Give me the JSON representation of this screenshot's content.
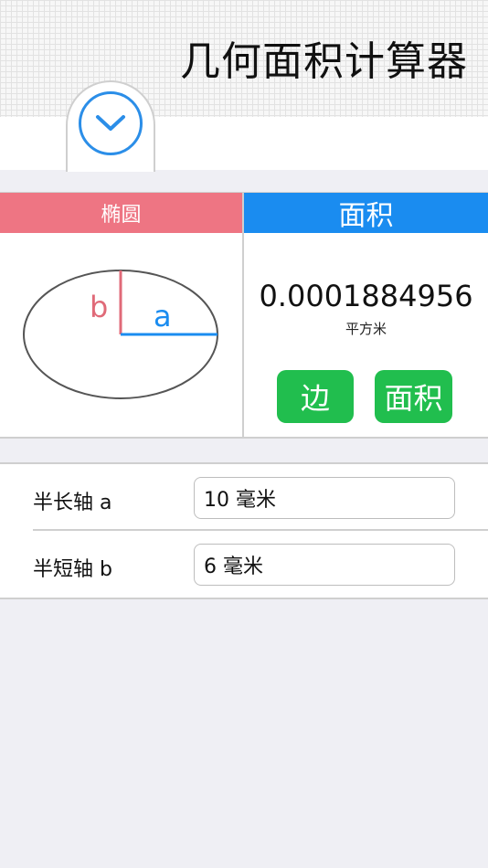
{
  "app": {
    "title": "几何面积计算器"
  },
  "shape": {
    "name": "椭圆"
  },
  "diagram": {
    "label_a": "a",
    "label_b": "b"
  },
  "result": {
    "header": "面积",
    "value": "0.0001884956",
    "unit": "平方米",
    "side_button": "边",
    "area_button": "面积"
  },
  "inputs": [
    {
      "label": "半长轴 a",
      "value": "10 毫米"
    },
    {
      "label": "半短轴 b",
      "value": "6 毫米"
    }
  ],
  "colors": {
    "shape_header": "#ee7583",
    "result_header": "#1a8cf0",
    "button_green": "#21be4e",
    "accent_blue": "#2b8ee8"
  },
  "icons": {
    "toggle": "chevron-down-icon"
  }
}
